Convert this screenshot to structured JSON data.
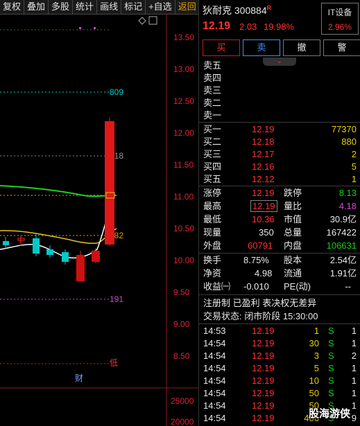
{
  "toolbar": {
    "items": [
      "复权",
      "叠加",
      "多股",
      "统计",
      "画线",
      "标记",
      "+自选"
    ],
    "return_label": "返回"
  },
  "chart": {
    "price_axis": [
      "13.50",
      "13.00",
      "12.50",
      "12.00",
      "11.50",
      "11.00",
      "10.50",
      "10.00",
      "9.50",
      "9.00",
      "8.50"
    ],
    "volume_axis": [
      "25000",
      "20000"
    ],
    "fib_labels": [
      "809",
      "618",
      "382",
      "191"
    ],
    "low_label": "低",
    "cai_label": "财",
    "colors": {
      "up": "#ff2020",
      "down": "#00c8c8",
      "ma_green": "#20d020",
      "ma_yellow": "#e8c020",
      "ma_white": "#ffffff"
    }
  },
  "stock": {
    "name": "狄耐克",
    "code": "300884",
    "badge": "R",
    "price": "12.19",
    "change": "2.03",
    "pct": "19.98%",
    "sector_name": "IT设备",
    "sector_pct": "2.96%"
  },
  "actions": {
    "buy": "买",
    "sell": "卖",
    "cancel": "撤",
    "alert": "警"
  },
  "sell_orders": [
    {
      "label": "卖五"
    },
    {
      "label": "卖四"
    },
    {
      "label": "卖三"
    },
    {
      "label": "卖二"
    },
    {
      "label": "卖一"
    }
  ],
  "buy_orders": [
    {
      "label": "买一",
      "price": "12.19",
      "vol": "77370"
    },
    {
      "label": "买二",
      "price": "12.18",
      "vol": "880"
    },
    {
      "label": "买三",
      "price": "12.17",
      "vol": "2"
    },
    {
      "label": "买四",
      "price": "12.16",
      "vol": "5"
    },
    {
      "label": "买五",
      "price": "12.12",
      "vol": "1"
    }
  ],
  "quote": {
    "zhangting_label": "涨停",
    "zhangting": "12.19",
    "dieting_label": "跌停",
    "dieting": "8.13",
    "high_label": "最高",
    "high": "12.19",
    "liangbi_label": "量比",
    "liangbi": "4.18",
    "low_label": "最低",
    "low": "10.36",
    "shizhi_label": "市值",
    "shizhi": "30.9亿",
    "xianliang_label": "现量",
    "xianliang": "350",
    "zongliang_label": "总量",
    "zongliang": "167422",
    "waipan_label": "外盘",
    "waipan": "60791",
    "neipan_label": "内盘",
    "neipan": "106631",
    "huanshou_label": "换手",
    "huanshou": "8.75%",
    "guben_label": "股本",
    "guben": "2.54亿",
    "jingzi_label": "净资",
    "jingzi": "4.98",
    "liutong_label": "流通",
    "liutong": "1.91亿",
    "shouyi_label": "收益㈠",
    "shouyi": "-0.010",
    "pe_label": "PE(动)",
    "pe": "--"
  },
  "notes": {
    "line1": "注册制 已盈利 表决权无差异",
    "line2": "交易状态: 闭市阶段 15:30:00"
  },
  "ticks": [
    {
      "time": "14:53",
      "price": "12.19",
      "vol": "1",
      "bs": "S",
      "n": "1"
    },
    {
      "time": "14:54",
      "price": "12.19",
      "vol": "30",
      "bs": "S",
      "n": "1"
    },
    {
      "time": "14:54",
      "price": "12.19",
      "vol": "3",
      "bs": "S",
      "n": "2"
    },
    {
      "time": "14:54",
      "price": "12.19",
      "vol": "5",
      "bs": "S",
      "n": "1"
    },
    {
      "time": "14:54",
      "price": "12.19",
      "vol": "10",
      "bs": "S",
      "n": "1"
    },
    {
      "time": "14:54",
      "price": "12.19",
      "vol": "50",
      "bs": "S",
      "n": "1"
    },
    {
      "time": "14:54",
      "price": "12.19",
      "vol": "50",
      "bs": "S",
      "n": "1"
    },
    {
      "time": "14:54",
      "price": "12.19",
      "vol": "486",
      "bs": "S",
      "n": "9"
    }
  ],
  "watermark": "股海游侠"
}
